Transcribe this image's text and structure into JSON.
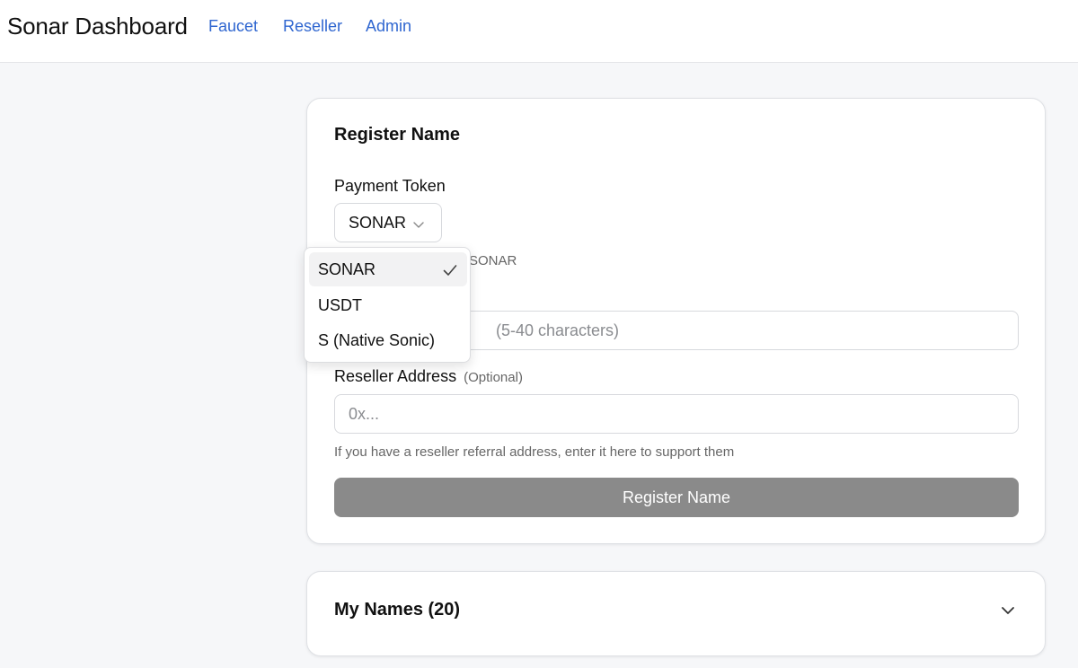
{
  "header": {
    "title": "Sonar Dashboard",
    "nav": [
      "Faucet",
      "Reseller",
      "Admin"
    ]
  },
  "register_card": {
    "title": "Register Name",
    "payment_token": {
      "label": "Payment Token",
      "selected": "SONAR",
      "hint_visible_fragment": "SONAR"
    },
    "name_field": {
      "placeholder_visible_fragment": "(5-40 characters)"
    },
    "reseller": {
      "label": "Reseller Address",
      "optional": "(Optional)",
      "placeholder": "0x...",
      "help": "If you have a reseller referral address, enter it here to support them"
    },
    "submit_label": "Register Name"
  },
  "dropdown": {
    "options": [
      "SONAR",
      "USDT",
      "S (Native Sonic)"
    ],
    "selected": "SONAR"
  },
  "names_card": {
    "title": "My Names (20)"
  },
  "colors": {
    "link": "#2f66d0",
    "button_disabled": "#8a8a8a",
    "background": "#f6f7f9"
  }
}
